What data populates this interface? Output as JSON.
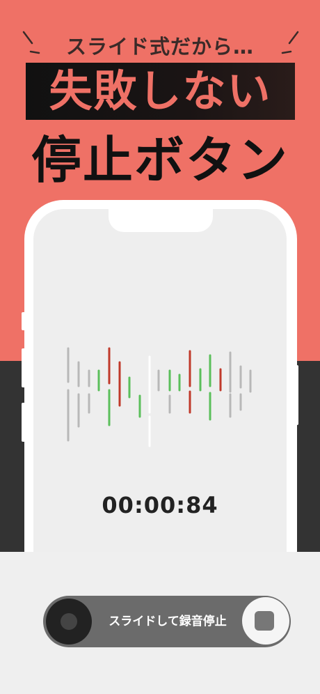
{
  "promo": {
    "tagline": "スライド式だから…",
    "headline": "失敗しない",
    "headline2": "停止ボタン"
  },
  "recorder": {
    "timer": "00:00:84",
    "slider_label": "スライドして録音停止"
  },
  "colors": {
    "background_top": "#ef7166",
    "background_bottom": "#333333",
    "wave_red": "#c0392b",
    "wave_green": "#5bbf5b",
    "wave_gray": "#b8b8b8",
    "wave_white": "#ffffff"
  },
  "icons": {
    "stop": "stop-square-icon",
    "record_knob": "record-knob-icon"
  }
}
